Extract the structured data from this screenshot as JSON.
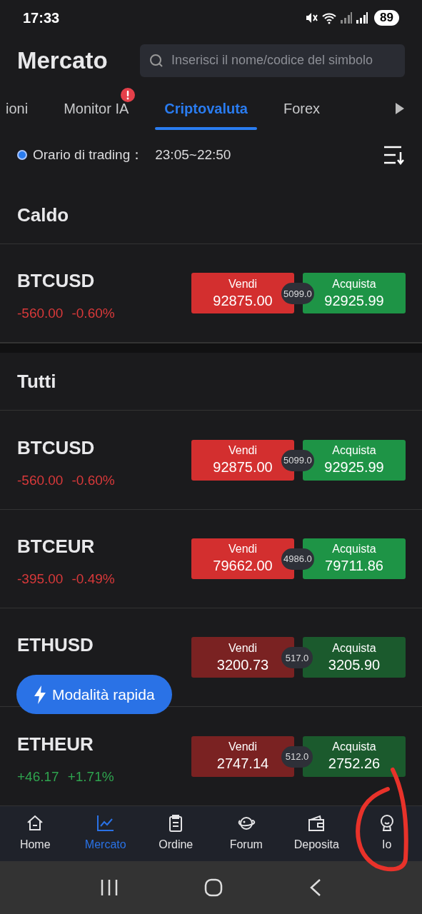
{
  "status_bar": {
    "time": "17:33",
    "battery": "89"
  },
  "header": {
    "title": "Mercato",
    "search": {
      "placeholder": "Inserisci il nome/codice del simbolo"
    }
  },
  "tabs": [
    {
      "label": "ioni",
      "selected": false,
      "alert": false
    },
    {
      "label": "Monitor IA",
      "selected": false,
      "alert": true
    },
    {
      "label": "Criptovaluta",
      "selected": true,
      "alert": false
    },
    {
      "label": "Forex",
      "selected": false,
      "alert": false
    }
  ],
  "trading_hours": {
    "label": "Orario di trading：",
    "value": "23:05~22:50"
  },
  "sections": [
    {
      "title": "Caldo",
      "rows": [
        {
          "symbol": "BTCUSD",
          "change": "-560.00",
          "percent": "-0.60%",
          "color": "#d8393a",
          "flash": true,
          "sell_label": "Vendi",
          "sell": "92875.00",
          "spread": "5099.0",
          "buy_label": "Acquista",
          "buy": "92925.99"
        }
      ]
    },
    {
      "title": "Tutti",
      "rows": [
        {
          "symbol": "BTCUSD",
          "change": "-560.00",
          "percent": "-0.60%",
          "color": "#d8393a",
          "flash": true,
          "sell_label": "Vendi",
          "sell": "92875.00",
          "spread": "5099.0",
          "buy_label": "Acquista",
          "buy": "92925.99"
        },
        {
          "symbol": "BTCEUR",
          "change": "-395.00",
          "percent": "-0.49%",
          "color": "#d8393a",
          "flash": true,
          "sell_label": "Vendi",
          "sell": "79662.00",
          "spread": "4986.0",
          "buy_label": "Acquista",
          "buy": "79711.86"
        },
        {
          "symbol": "ETHUSD",
          "flash": false,
          "sell_label": "Vendi",
          "sell": "3200.73",
          "spread": "517.0",
          "buy_label": "Acquista",
          "buy": "3205.90"
        },
        {
          "symbol": "ETHEUR",
          "change": "+46.17",
          "percent": "+1.71%",
          "color": "#2fa44f",
          "flash": false,
          "sell_label": "Vendi",
          "sell": "2747.14",
          "spread": "512.0",
          "buy_label": "Acquista",
          "buy": "2752.26"
        }
      ]
    }
  ],
  "quick_mode_button": {
    "label": "Modalità rapida"
  },
  "bottom_nav": [
    {
      "label": "Home",
      "selected": false
    },
    {
      "label": "Mercato",
      "selected": true
    },
    {
      "label": "Ordine",
      "selected": false
    },
    {
      "label": "Forum",
      "selected": false
    },
    {
      "label": "Deposita",
      "selected": false
    },
    {
      "label": "Io",
      "selected": false
    }
  ]
}
